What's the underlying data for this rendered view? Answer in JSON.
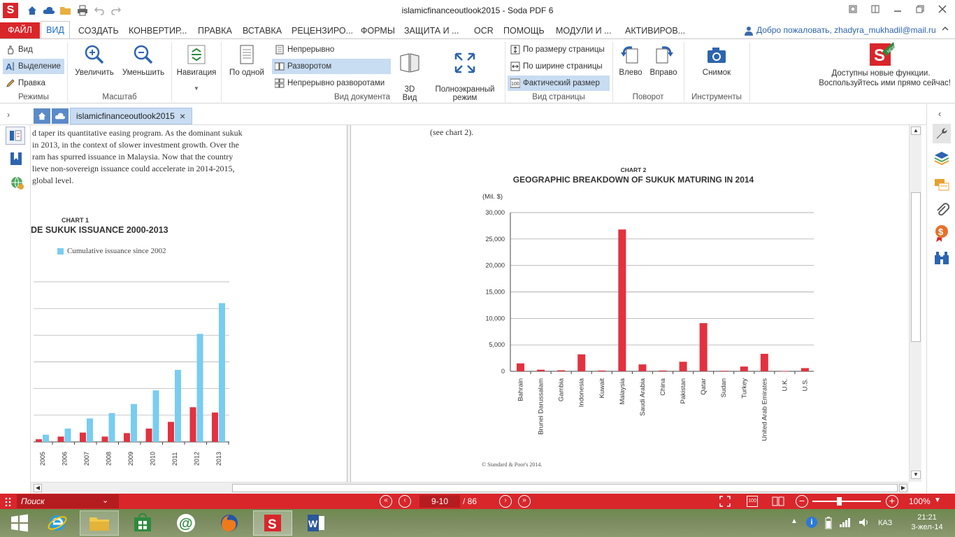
{
  "window": {
    "app_title": "islamicfinanceoutlook2015   -   Soda PDF 6",
    "qat_icons": [
      "home-icon",
      "cloud-icon",
      "open-folder-icon",
      "print-icon",
      "undo-icon",
      "redo-icon"
    ]
  },
  "menu": {
    "items": [
      "ФАЙЛ",
      "ВИД",
      "СОЗДАТЬ",
      "КОНВЕРТИР...",
      "ПРАВКА",
      "ВСТАВКА",
      "РЕЦЕНЗИРО...",
      "ФОРМЫ",
      "ЗАЩИТА И ...",
      "OCR",
      "ПОМОЩЬ",
      "МОДУЛИ И ...",
      "АКТИВИРОВ..."
    ],
    "welcome": "Добро пожаловать, zhadyra_mukhadil@mail.ru"
  },
  "ribbon": {
    "modes": {
      "label": "Режимы",
      "view": "Вид",
      "select": "Выделение",
      "edit": "Правка"
    },
    "zoom": {
      "label": "Масштаб",
      "zoom_in": "Увеличить",
      "zoom_out": "Уменьшить"
    },
    "navigation": {
      "label": "Навигация"
    },
    "doc_view": {
      "label": "Вид документа",
      "single": "По одной",
      "continuous": "Непрерывно",
      "spread": "Разворотом",
      "continuous_spread": "Непрерывно разворотами",
      "view3d": "3D\nВид",
      "fullscreen": "Полноэкранный\nрежим"
    },
    "page_view": {
      "label": "Вид страницы",
      "fit_page": "По размеру страницы",
      "fit_width": "По ширине страницы",
      "actual": "Фактический размер"
    },
    "rotate": {
      "label": "Поворот",
      "left": "Влево",
      "right": "Вправо"
    },
    "tools": {
      "label": "Инструменты",
      "snapshot": "Снимок"
    },
    "promo": {
      "line1": "Доступны новые функции.",
      "line2": "Воспользуйтесь ими прямо сейчас!",
      "badge": "NEW"
    }
  },
  "tabs": {
    "document": "islamicfinanceoutlook2015"
  },
  "page_left": {
    "text_lines": [
      "d taper its quantitative easing program. As the dominant sukuk",
      "in 2013, in the context of slower investment growth. Over the",
      "ram has spurred issuance in Malaysia. Now that the country",
      "lieve non-sovereign issuance could accelerate in 2014-2015,",
      "global level."
    ],
    "chart_label": "CHART 1",
    "chart_title": "DE SUKUK ISSUANCE 2000-2013",
    "legend": "Cumulative issuance since 2002"
  },
  "page_right": {
    "intro": "(see chart 2).",
    "copyright": "© Standard & Poor's 2014."
  },
  "chart_data": [
    {
      "type": "bar",
      "label": "CHART 1",
      "title": "DE SUKUK ISSUANCE 2000-2013",
      "categories": [
        "2005",
        "2006",
        "2007",
        "2008",
        "2009",
        "2010",
        "2011",
        "2012",
        "2013"
      ],
      "series": [
        {
          "name": "",
          "color": "#e2323f",
          "values": [
            1.0,
            2.0,
            3.5,
            2.0,
            3.3,
            5.0,
            7.5,
            13.0,
            11.0
          ]
        },
        {
          "name": "Cumulative issuance since 2002",
          "color": "#78cdf0",
          "values": [
            2.7,
            5.0,
            8.8,
            10.8,
            14.2,
            19.3,
            27.0,
            40.5,
            52.0
          ]
        }
      ],
      "ylim": [
        0,
        60
      ],
      "grid": true
    },
    {
      "type": "bar",
      "label": "CHART 2",
      "title": "GEOGRAPHIC BREAKDOWN OF SUKUK MATURING IN 2014",
      "ylabel": "(Mil. $)",
      "categories": [
        "Bahrain",
        "Brunei Darussalam",
        "Gambia",
        "Indonesia",
        "Kuwait",
        "Malaysia",
        "Saudi Arabia",
        "China",
        "Pakistan",
        "Qatar",
        "Sudan",
        "Turkey",
        "United Arab Emirates",
        "U.K.",
        "U.S."
      ],
      "values": [
        1500,
        300,
        200,
        3200,
        150,
        26800,
        1300,
        150,
        1800,
        9100,
        100,
        900,
        3300,
        50,
        600
      ],
      "yticks": [
        "0",
        "5,000",
        "10,000",
        "15,000",
        "20,000",
        "25,000",
        "30,000"
      ],
      "ylim": [
        0,
        30000
      ],
      "grid": true,
      "color": "#e2323f"
    }
  ],
  "status": {
    "search": "Поиск",
    "page_current": "9-10",
    "page_total": "/ 86",
    "zoom": "100%",
    "actual_size_badge": "100"
  },
  "taskbar": {
    "time": "21:21",
    "date": "3-жел-14",
    "lang": "КАЗ"
  }
}
